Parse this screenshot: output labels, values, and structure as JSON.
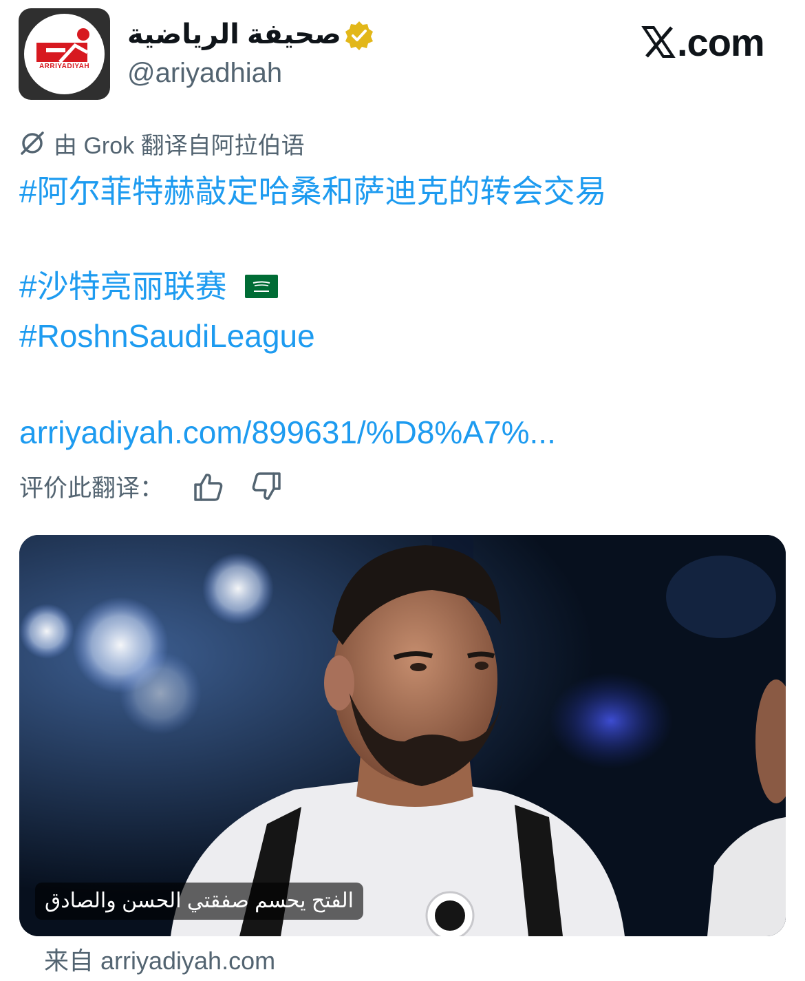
{
  "account": {
    "display_name": "صحيفة الرياضية",
    "handle": "@ariyadhiah",
    "avatar_text": "ARRIYADIYAH",
    "verified": true
  },
  "site_logo": {
    "mark": "𝕏",
    "label": ".com"
  },
  "translation": {
    "note": "由 Grok 翻译自阿拉伯语",
    "rate_label": "评价此翻译："
  },
  "tweet": {
    "line1": "#阿尔菲特赫敲定哈桑和萨迪克的转会交易",
    "line2": "#沙特亮丽联赛",
    "line3": "#RoshnSaudiLeague",
    "link": "arriyadiyah.com/899631/%D8%A7%..."
  },
  "card": {
    "caption": "الفتح يحسم صفقتي الحسن والصادق",
    "source": "来自 arriyadiyah.com"
  },
  "colors": {
    "link": "#1d9bf0",
    "muted": "#536471",
    "verified": "#e2b719"
  },
  "icons": [
    "grok-icon",
    "thumbs-up-icon",
    "thumbs-down-icon",
    "verified-badge-icon",
    "saudi-flag-icon"
  ]
}
